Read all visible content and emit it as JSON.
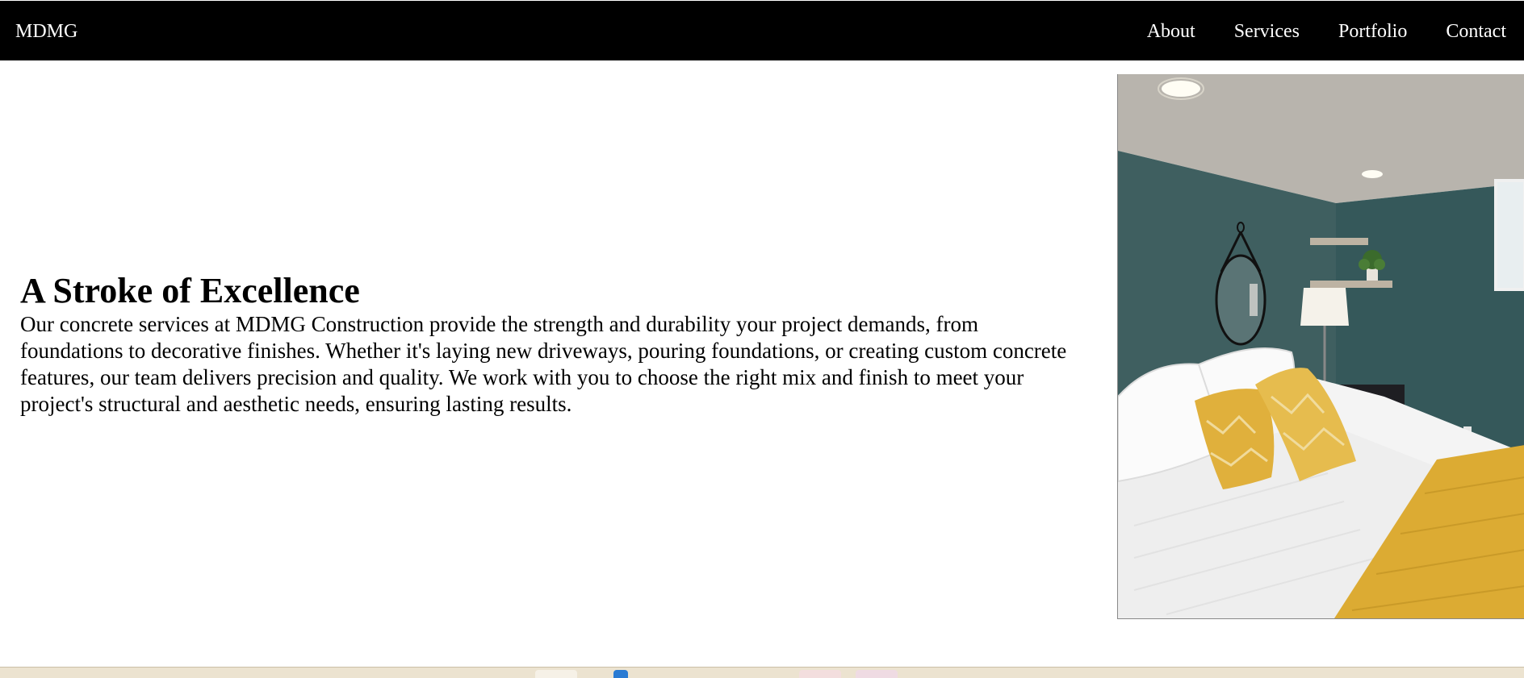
{
  "nav": {
    "brand": "MDMG",
    "links": [
      "About",
      "Services",
      "Portfolio",
      "Contact"
    ]
  },
  "hero": {
    "title": "A Stroke of Excellence",
    "body": "Our concrete services at MDMG Construction provide the strength and durability your project demands, from foundations to decorative finishes. Whether it's laying new driveways, pouring foundations, or creating custom concrete features, our team delivers precision and quality. We work with you to choose the right mix and finish to meet your project's structural and aesthetic needs, ensuring lasting results."
  },
  "colors": {
    "navbar_bg": "#000000",
    "nav_text": "#ffffff",
    "wall": "#3f5f60",
    "pillow_accent": "#e0b03c",
    "throw_blanket": "#dcab33",
    "bedding": "#f4f4f4"
  },
  "image": {
    "subject": "bedroom-photo"
  }
}
